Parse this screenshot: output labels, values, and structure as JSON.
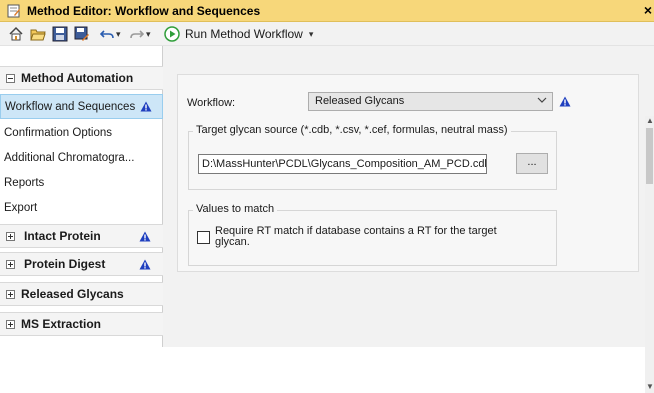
{
  "window": {
    "title": "Method Editor: Workflow and Sequences",
    "close_glyph": "×"
  },
  "toolbar": {
    "icons": [
      "home-icon",
      "open-icon",
      "save-icon",
      "save-as-icon",
      "undo-icon",
      "redo-icon",
      "run-icon"
    ],
    "run_label": "Run Method Workflow",
    "dropdown_glyph": "▾"
  },
  "sidebar": {
    "header": "Method Automation",
    "items": [
      {
        "label": "Workflow and Sequences",
        "active": true,
        "warning": true
      },
      {
        "label": "Confirmation Options",
        "active": false,
        "warning": false
      },
      {
        "label": "Additional Chromatogra...",
        "active": false,
        "warning": false
      },
      {
        "label": "Reports",
        "active": false,
        "warning": false
      },
      {
        "label": "Export",
        "active": false,
        "warning": false
      }
    ],
    "sections": [
      {
        "label": "Intact Protein",
        "warning": true
      },
      {
        "label": "Protein Digest",
        "warning": true
      },
      {
        "label": "Released Glycans",
        "warning": false
      },
      {
        "label": "MS Extraction",
        "warning": false
      }
    ]
  },
  "main": {
    "workflow_label": "Workflow:",
    "workflow_value": "Released Glycans",
    "source_group_title": "Target glycan source (*.cdb, *.csv, *.cef, formulas, neutral mass)",
    "source_path": "D:\\MassHunter\\PCDL\\Glycans_Composition_AM_PCD.cdb",
    "browse_label": "...",
    "values_group_title": "Values to match",
    "rt_checkbox_label_line1": "Require RT match if database contains a RT for the target",
    "rt_checkbox_label_line2": "glycan.",
    "rt_checked": false
  },
  "colors": {
    "titlebar": "#f7d77a",
    "active_item": "#cde6f7",
    "warning_blue": "#1f3fbf",
    "run_green": "#2f9e3a"
  }
}
